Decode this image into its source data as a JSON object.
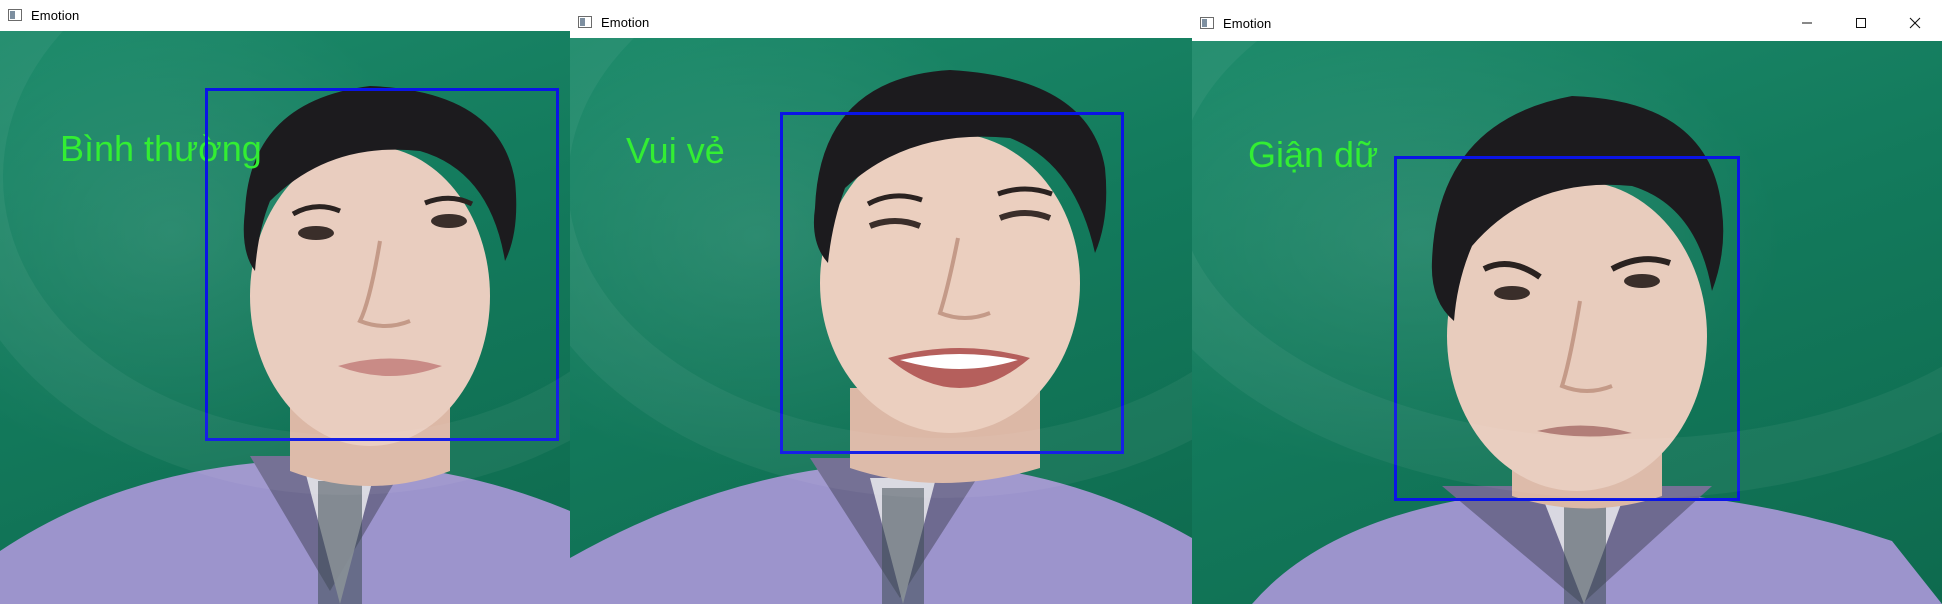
{
  "windows": [
    {
      "title": "Emotion",
      "icon": "app-window-icon",
      "emotion_label": "Bình thường",
      "label_color": "#33ee33",
      "box_color": "#0a14e6",
      "expression": "neutral"
    },
    {
      "title": "Emotion",
      "icon": "app-window-icon",
      "emotion_label": "Vui vẻ",
      "label_color": "#33ee33",
      "box_color": "#0a14e6",
      "expression": "happy"
    },
    {
      "title": "Emotion",
      "icon": "app-window-icon",
      "emotion_label": "Giận dữ",
      "label_color": "#33ee33",
      "box_color": "#0a14e6",
      "expression": "angry",
      "controls": [
        "minimize-icon",
        "maximize-icon",
        "close-icon"
      ]
    }
  ]
}
